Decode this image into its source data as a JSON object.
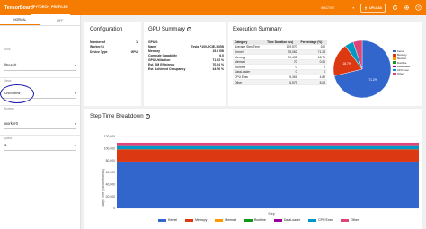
{
  "app": {
    "brand": "TensorBoard",
    "active_tab": "PYTORCH_PROFILER",
    "status": "INACTIVE",
    "upload_label": "UPLOAD"
  },
  "sidebar": {
    "modes": [
      "NORMAL",
      "DIFF"
    ],
    "runs_label": "Runs",
    "runs_value": "lltresult",
    "views_label": "Views",
    "views_value": "Overview",
    "workers_label": "Workers",
    "workers_value": "worker0",
    "spans_label": "Spans",
    "spans_value": "1"
  },
  "configuration": {
    "title": "Configuration",
    "rows": [
      {
        "k": "Number of",
        "v": "1"
      },
      {
        "k": "Worker(s)",
        "v": ""
      },
      {
        "k": "Device Type",
        "v": "GPU"
      }
    ]
  },
  "gpu_summary": {
    "title": "GPU Summary",
    "rows": [
      {
        "k": "GPU 0:",
        "v": ""
      },
      {
        "k": "Name",
        "v": "Tesla P100-PCIE-16GB"
      },
      {
        "k": "Memory",
        "v": "15.9 GB"
      },
      {
        "k": "Compute Capability",
        "v": "6.0"
      },
      {
        "k": "GPU Utilization",
        "v": "71.23 %"
      },
      {
        "k": "Est. SM Efficiency",
        "v": "70.04 %"
      },
      {
        "k": "Est. Achieved Occupancy",
        "v": "44.76 %"
      }
    ]
  },
  "execution_summary": {
    "title": "Execution Summary",
    "headers": [
      "Category",
      "Time Duration (us)",
      "Percentage (%)"
    ],
    "rows": [
      [
        "Average Step Time",
        "109,570",
        "100"
      ],
      [
        "Kernel",
        "78,062",
        "71.23"
      ],
      [
        "Memcpy",
        "20,498",
        "18.71"
      ],
      [
        "Memset",
        "70",
        "0.06"
      ],
      [
        "Runtime",
        "0",
        "0"
      ],
      [
        "DataLoader",
        "0",
        "0"
      ],
      [
        "CPU Exec",
        "5,361",
        "4.89"
      ],
      [
        "Other",
        "5,579",
        "5.09"
      ]
    ],
    "pie_center_label": "71.2%",
    "pie_memcpy_label": "18.7%",
    "legend": [
      {
        "name": "Kernel",
        "color": "#3366cc"
      },
      {
        "name": "Memcpy",
        "color": "#dc3912"
      },
      {
        "name": "Memset",
        "color": "#ff9900"
      },
      {
        "name": "Runtime",
        "color": "#109618"
      },
      {
        "name": "DataLoader",
        "color": "#990099"
      },
      {
        "name": "CPU Exec",
        "color": "#0099c6"
      },
      {
        "name": "Other",
        "color": "#dd4477"
      }
    ]
  },
  "step_time": {
    "title": "Step Time Breakdown"
  },
  "chart_data": {
    "type": "area",
    "title": "Step Time Breakdown",
    "xlabel": "Step",
    "ylabel": "Step Time (microseconds)",
    "ylim": [
      0,
      120000
    ],
    "yticks": [
      "120,000",
      "100,000",
      "80,000",
      "60,000",
      "40,000",
      "20,000",
      "0"
    ],
    "legend_placement": "bottom",
    "series": [
      {
        "name": "Kernel",
        "color": "#3366cc",
        "value": 78062
      },
      {
        "name": "Memcpy",
        "color": "#dc3912",
        "value": 20498
      },
      {
        "name": "Memset",
        "color": "#ff9900",
        "value": 70
      },
      {
        "name": "Runtime",
        "color": "#109618",
        "value": 0
      },
      {
        "name": "DataLoader",
        "color": "#990099",
        "value": 0
      },
      {
        "name": "CPU Exec",
        "color": "#0099c6",
        "value": 5361
      },
      {
        "name": "Other",
        "color": "#dd4477",
        "value": 5579
      }
    ]
  }
}
